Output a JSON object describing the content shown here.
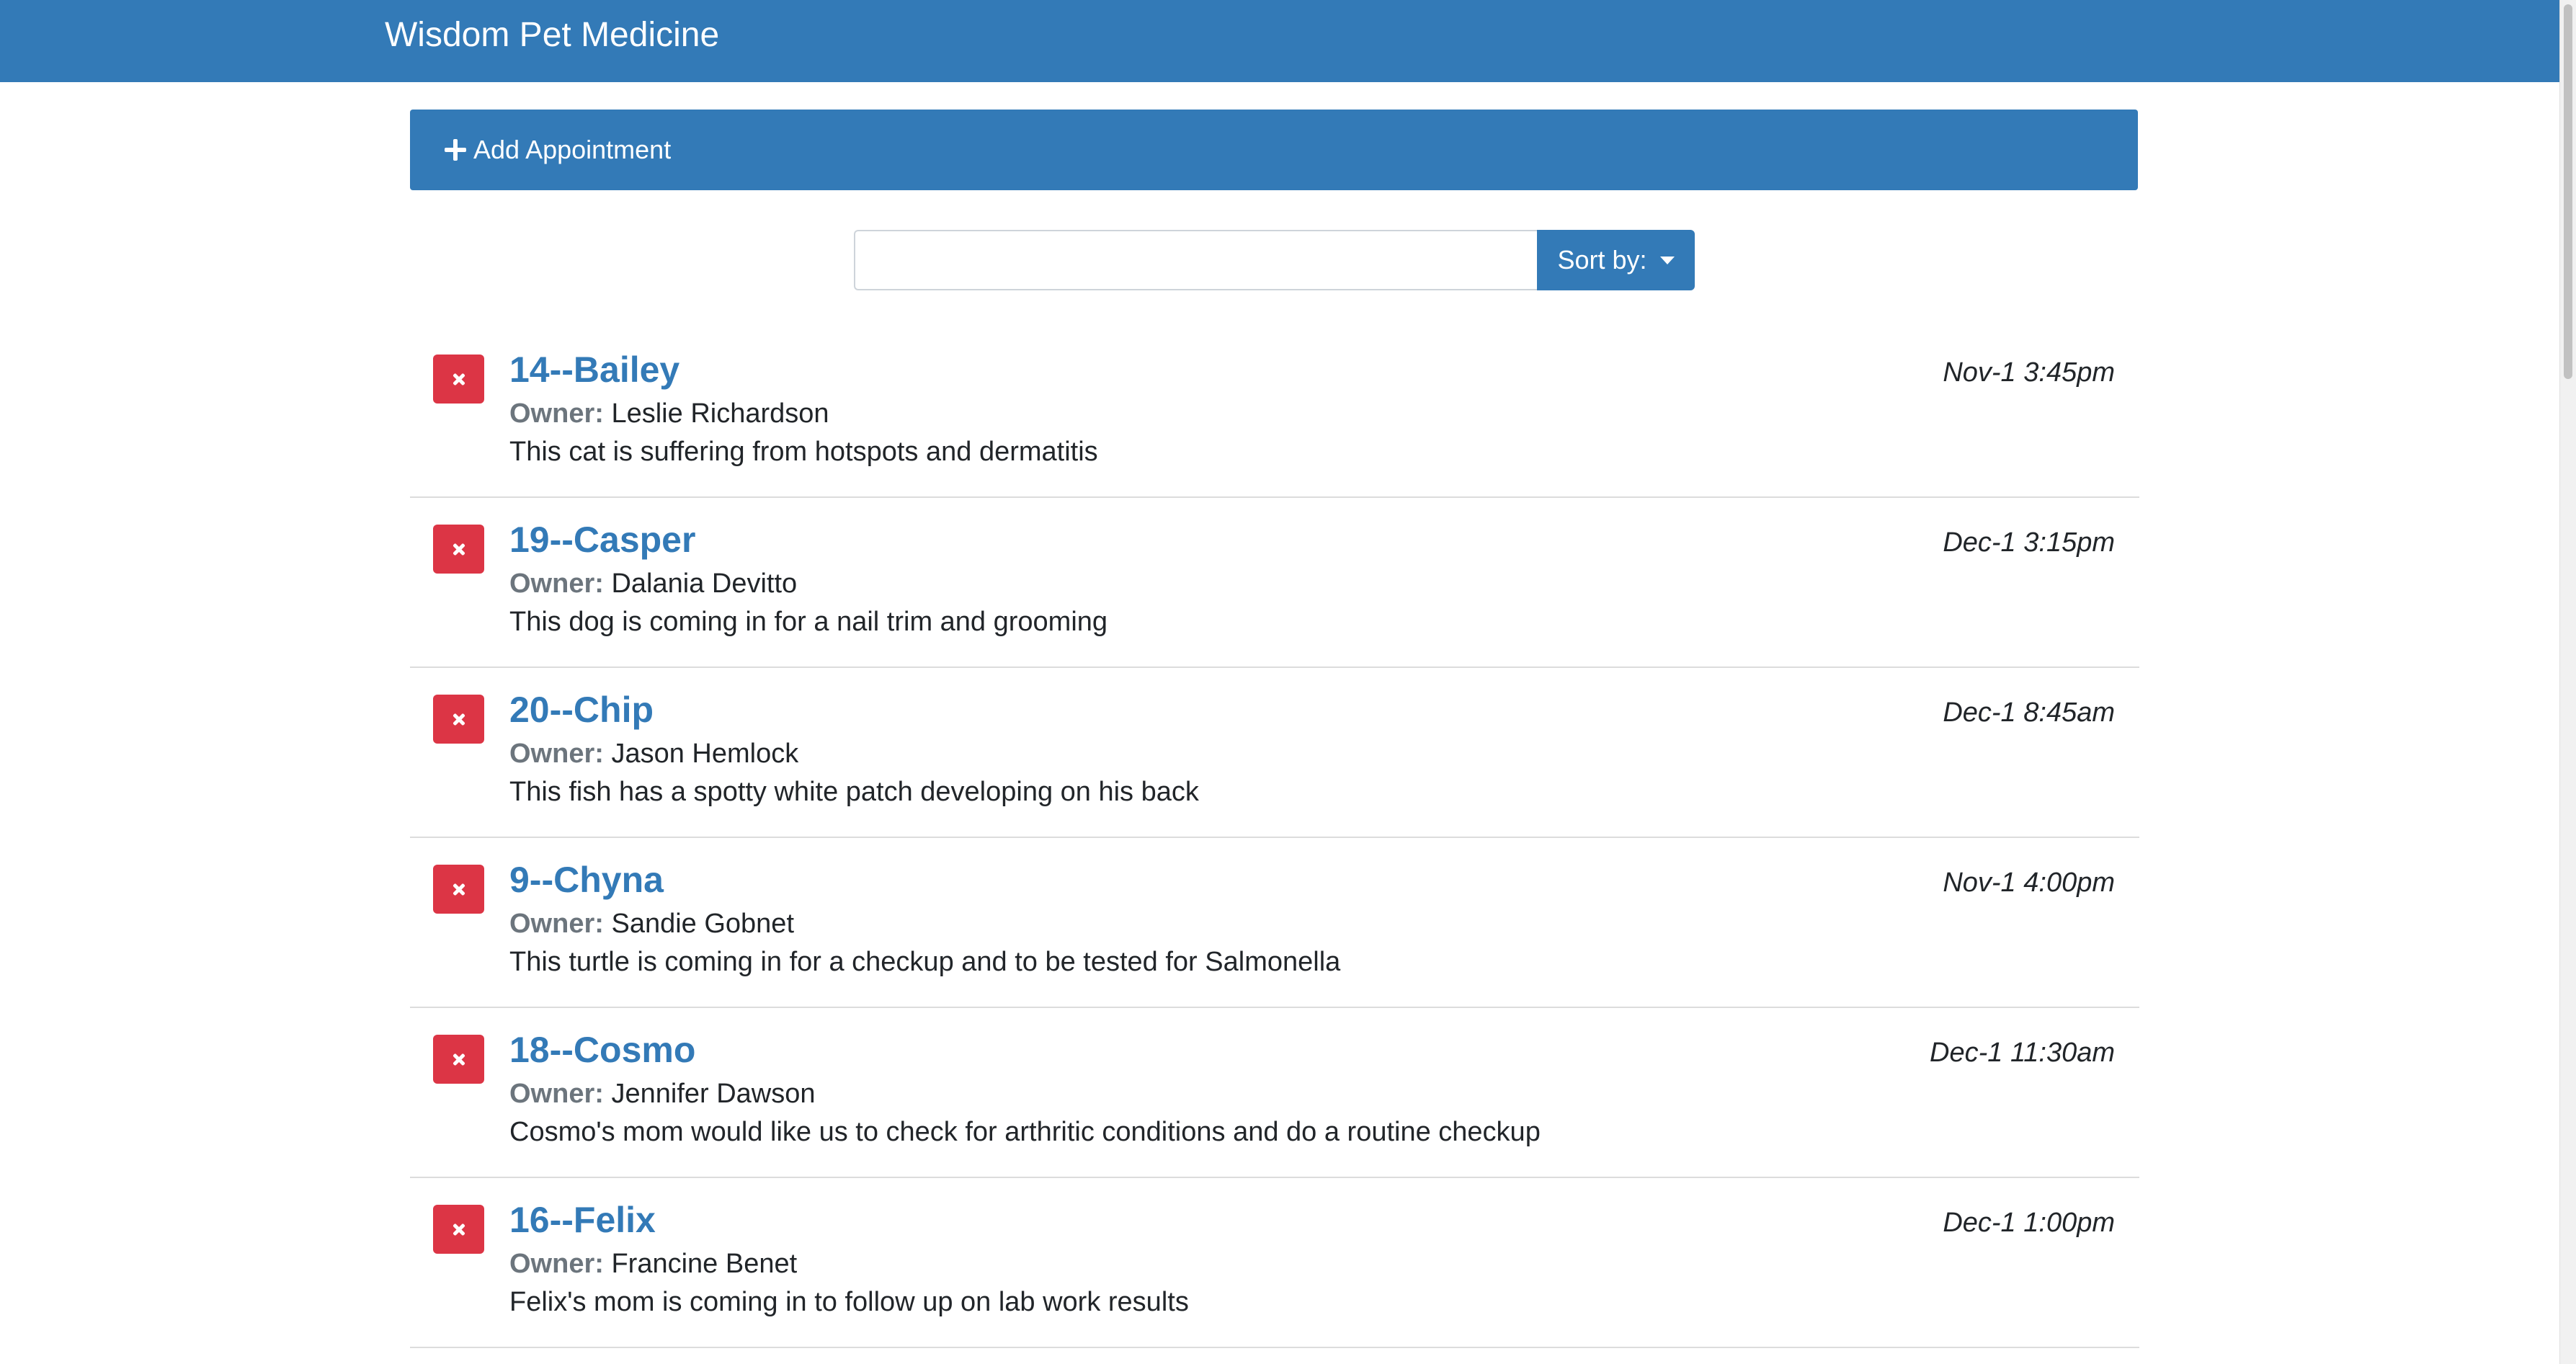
{
  "header": {
    "title": "Wisdom Pet Medicine"
  },
  "add_appointment": {
    "label": "Add Appointment",
    "icon": "plus-icon"
  },
  "search": {
    "value": "",
    "placeholder": ""
  },
  "sort": {
    "label": "Sort by:",
    "icon": "caret-down-icon"
  },
  "colors": {
    "primary": "#337ab7",
    "danger": "#dc3545"
  },
  "appointments": [
    {
      "pet": "14--Bailey",
      "owner_label": "Owner:",
      "owner": "Leslie Richardson",
      "notes": "This cat is suffering from hotspots and dermatitis",
      "date": "Nov-1 3:45pm"
    },
    {
      "pet": "19--Casper",
      "owner_label": "Owner:",
      "owner": "Dalania Devitto",
      "notes": "This dog is coming in for a nail trim and grooming",
      "date": "Dec-1 3:15pm"
    },
    {
      "pet": "20--Chip",
      "owner_label": "Owner:",
      "owner": "Jason Hemlock",
      "notes": "This fish has a spotty white patch developing on his back",
      "date": "Dec-1 8:45am"
    },
    {
      "pet": "9--Chyna",
      "owner_label": "Owner:",
      "owner": "Sandie Gobnet",
      "notes": "This turtle is coming in for a checkup and to be tested for Salmonella",
      "date": "Nov-1 4:00pm"
    },
    {
      "pet": "18--Cosmo",
      "owner_label": "Owner:",
      "owner": "Jennifer Dawson",
      "notes": "Cosmo's mom would like us to check for arthritic conditions and do a routine checkup",
      "date": "Dec-1 11:30am"
    },
    {
      "pet": "16--Felix",
      "owner_label": "Owner:",
      "owner": "Francine Benet",
      "notes": "Felix's mom is coming in to follow up on lab work results",
      "date": "Dec-1 1:00pm"
    }
  ]
}
